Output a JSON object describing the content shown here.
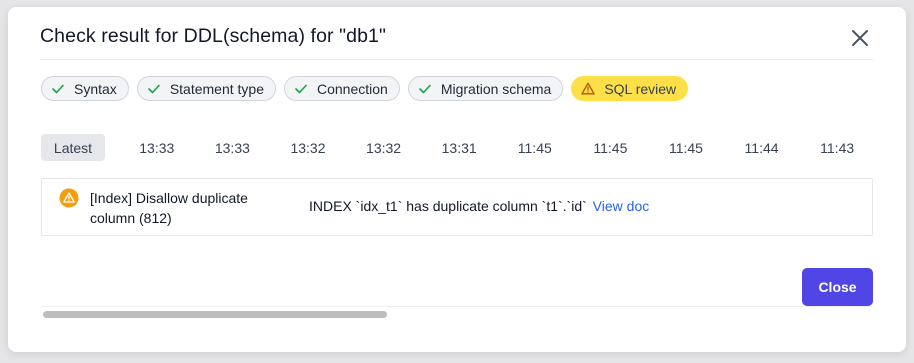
{
  "dialog": {
    "title": "Check result for DDL(schema) for \"db1\"",
    "close_icon": "close-icon"
  },
  "checks": [
    {
      "label": "Syntax",
      "status": "success",
      "icon": "check-icon"
    },
    {
      "label": "Statement type",
      "status": "success",
      "icon": "check-icon"
    },
    {
      "label": "Connection",
      "status": "success",
      "icon": "check-icon"
    },
    {
      "label": "Migration schema",
      "status": "success",
      "icon": "check-icon"
    },
    {
      "label": "SQL review",
      "status": "warning",
      "icon": "warning-icon"
    }
  ],
  "timeline": {
    "latest_label": "Latest",
    "times": [
      "13:33",
      "13:33",
      "13:32",
      "13:32",
      "13:31",
      "11:45",
      "11:45",
      "11:45",
      "11:44",
      "11:43"
    ]
  },
  "result": {
    "icon": "warning-circle-icon",
    "rule_title": "[Index] Disallow duplicate column (812)",
    "message": "INDEX `idx_t1` has duplicate column `t1`.`id`",
    "link_label": "View doc"
  },
  "footer": {
    "close_label": "Close"
  },
  "colors": {
    "primary": "#4f46e5",
    "warning_chip": "#fde047",
    "success": "#16a34a",
    "warning_icon": "#f59e0b",
    "link": "#2563eb"
  }
}
